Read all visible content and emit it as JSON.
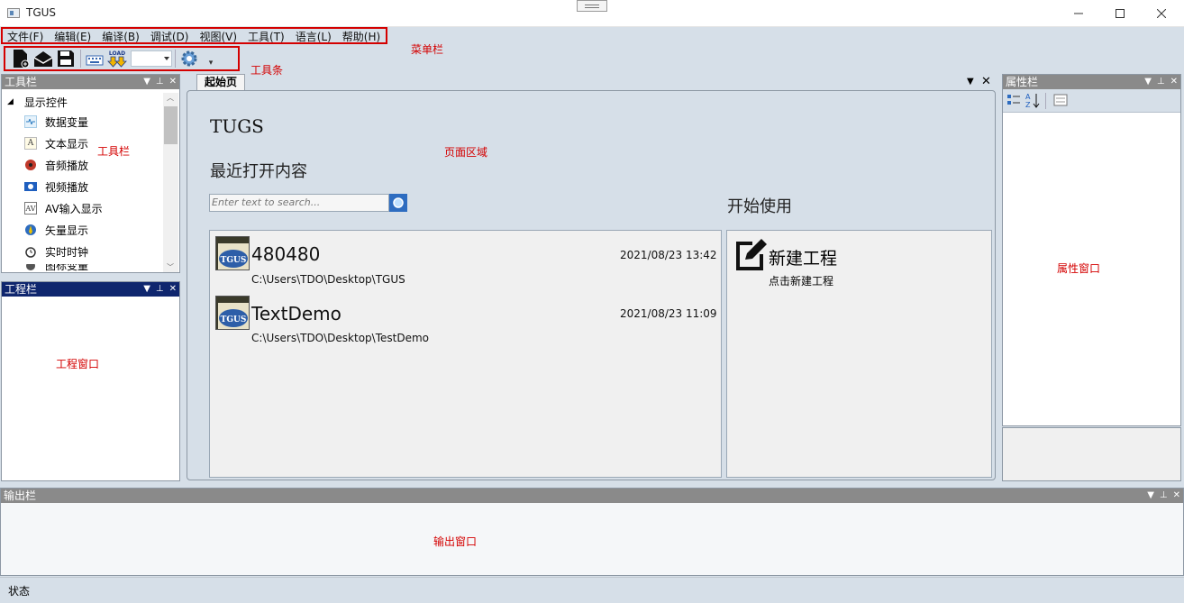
{
  "window": {
    "title": "TGUS"
  },
  "menu": [
    "文件(F)",
    "编辑(E)",
    "编译(B)",
    "调试(D)",
    "视图(V)",
    "工具(T)",
    "语言(L)",
    "帮助(H)"
  ],
  "toolbar": {
    "load_label": "LOAD"
  },
  "annotations": {
    "menubar": "菜单栏",
    "toolbar": "工具条",
    "toolbox": "工具栏",
    "page_area": "页面区域",
    "project_window": "工程窗口",
    "properties_window": "属性窗口",
    "output_window": "输出窗口"
  },
  "toolbox": {
    "title": "工具栏",
    "group": "显示控件",
    "items": [
      {
        "label": "数据变量",
        "icon": "data-variable-icon"
      },
      {
        "label": "文本显示",
        "icon": "text-display-icon"
      },
      {
        "label": "音频播放",
        "icon": "audio-play-icon"
      },
      {
        "label": "视频播放",
        "icon": "video-play-icon"
      },
      {
        "label": "AV输入显示",
        "icon": "av-input-icon"
      },
      {
        "label": "矢量显示",
        "icon": "vector-display-icon"
      },
      {
        "label": "实时时钟",
        "icon": "clock-icon"
      },
      {
        "label": "图标变量",
        "icon": "icon-variable-icon"
      }
    ],
    "av_icon_text": "AV"
  },
  "project_panel": {
    "title": "工程栏"
  },
  "properties_panel": {
    "title": "属性栏"
  },
  "output_panel": {
    "title": "输出栏"
  },
  "document": {
    "tab": "起始页",
    "app_name": "TUGS",
    "recent_heading": "最近打开内容",
    "search_placeholder": "Enter text to search...",
    "recent": [
      {
        "name": "480480",
        "date": "2021/08/23 13:42",
        "path": "C:\\Users\\TDO\\Desktop\\TGUS",
        "logo": "TGUS"
      },
      {
        "name": "TextDemo",
        "date": "2021/08/23 11:09",
        "path": "C:\\Users\\TDO\\Desktop\\TestDemo",
        "logo": "TGUS"
      }
    ],
    "start_heading": "开始使用",
    "new_project": {
      "title": "新建工程",
      "subtitle": "点击新建工程"
    }
  },
  "status": "状态",
  "colors": {
    "annotation_red": "#d40000",
    "active_header": "#0f266e",
    "inactive_header": "#8a8a8a",
    "search_button": "#2d6cc0"
  }
}
